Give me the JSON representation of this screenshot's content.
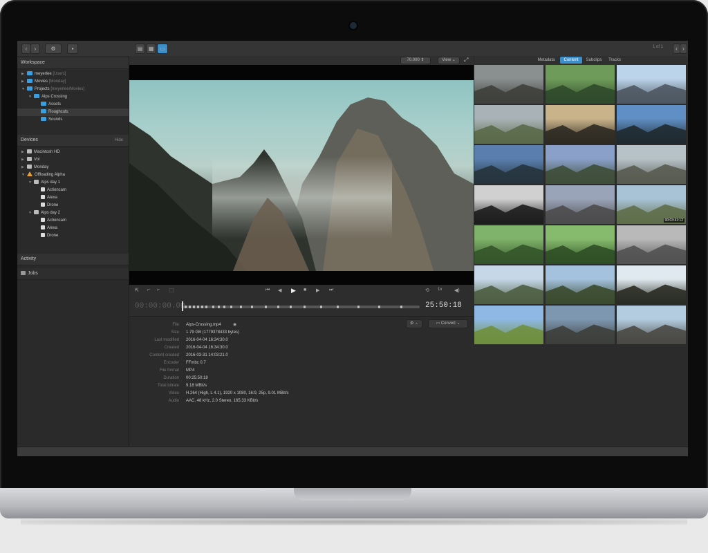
{
  "toolbar": {
    "nav_back": "‹",
    "nav_forward": "›",
    "gear": "⚙",
    "view_buttons": [
      "▤",
      "▦",
      "▭"
    ],
    "page_indicator": "1 of 1",
    "zoom_value": "70.000",
    "view_menu": "View",
    "tabs": [
      "Metadata",
      "Content",
      "Subclips",
      "Tracks"
    ],
    "active_tab": "Content"
  },
  "sidebar": {
    "workspace_title": "Workspace",
    "workspace": [
      {
        "label": "meyerlee",
        "muted": "[Users]",
        "depth": 0
      },
      {
        "label": "Movies",
        "muted": "[Monday]",
        "depth": 0
      },
      {
        "label": "Projects",
        "muted": "[meyerlee/Movies]",
        "depth": 0
      },
      {
        "label": "Alps Crossing",
        "muted": "",
        "depth": 1
      },
      {
        "label": "Assets",
        "muted": "",
        "depth": 2
      },
      {
        "label": "Roughcuts",
        "muted": "",
        "depth": 2
      },
      {
        "label": "Sounds",
        "muted": "",
        "depth": 2
      }
    ],
    "devices_title": "Devices",
    "devices_hide": "Hide",
    "devices": [
      {
        "label": "Macintosh HD",
        "depth": 0,
        "kind": "disk"
      },
      {
        "label": "Vol",
        "depth": 0,
        "kind": "disk"
      },
      {
        "label": "Monday",
        "depth": 0,
        "kind": "disk"
      },
      {
        "label": "Offloading Alpha",
        "depth": 0,
        "kind": "warn"
      },
      {
        "label": "Alps day 1",
        "depth": 1,
        "kind": "disk"
      },
      {
        "label": "Actioncam",
        "depth": 2,
        "kind": "sub"
      },
      {
        "label": "Alexa",
        "depth": 2,
        "kind": "sub"
      },
      {
        "label": "Drone",
        "depth": 2,
        "kind": "sub"
      },
      {
        "label": "Alps day 2",
        "depth": 1,
        "kind": "disk"
      },
      {
        "label": "Actioncam",
        "depth": 2,
        "kind": "sub"
      },
      {
        "label": "Alexa",
        "depth": 2,
        "kind": "sub"
      },
      {
        "label": "Drone",
        "depth": 2,
        "kind": "sub"
      }
    ],
    "activity_title": "Activity",
    "jobs_title": "Jobs"
  },
  "player": {
    "timecode_start": "00:00:00.00",
    "timecode_end": "25:50:18",
    "speed": "1x",
    "progress": 0.01
  },
  "info": {
    "convert_label": "Convert",
    "rows": [
      {
        "k": "File",
        "v": "Alps-Crossing.mp4"
      },
      {
        "k": "Size",
        "v": "1.79 GB (1779378433 bytes)"
      },
      {
        "k": "Last modified",
        "v": "2016-04-04 16:34:30.0"
      },
      {
        "k": "Created",
        "v": "2016-04-04 16:34:30.0"
      },
      {
        "k": "Content created",
        "v": "2016-03-31 14:03:21.0"
      },
      {
        "k": "Encoder",
        "v": "FFmbc 0.7"
      },
      {
        "k": "File format",
        "v": "MP4"
      },
      {
        "k": "Duration",
        "v": "00:25:50:18"
      },
      {
        "k": "Total bitrate",
        "v": "9.18 MBit/s"
      },
      {
        "k": "Video",
        "v": "H.264 (High, L 4.1), 1920 x 1080, 16:9, 25p, 9.01 MBit/s"
      },
      {
        "k": "Audio",
        "v": "AAC, 48 kHz, 2.0 Stereo, 165.33 KBit/s"
      }
    ]
  },
  "thumbnails": [
    {
      "c1": "#8a8f8f",
      "c2": "#3f403c",
      "dur": ""
    },
    {
      "c1": "#6f9b5a",
      "c2": "#2f4a2b",
      "dur": ""
    },
    {
      "c1": "#bcd4ea",
      "c2": "#4e5863",
      "dur": ""
    },
    {
      "c1": "#a9b3b7",
      "c2": "#5a6a4a",
      "dur": ""
    },
    {
      "c1": "#c9b38a",
      "c2": "#2e2a22",
      "dur": ""
    },
    {
      "c1": "#5f8fc4",
      "c2": "#1f2a30",
      "dur": ""
    },
    {
      "c1": "#5a7fae",
      "c2": "#26343d",
      "dur": ""
    },
    {
      "c1": "#8aa0c8",
      "c2": "#3e4e39",
      "dur": ""
    },
    {
      "c1": "#b7c2c8",
      "c2": "#585b50",
      "dur": ""
    },
    {
      "c1": "#d0d0d0",
      "c2": "#1d1d1d",
      "dur": ""
    },
    {
      "c1": "#9aa4b8",
      "c2": "#4c4b4c",
      "dur": ""
    },
    {
      "c1": "#a8c3d6",
      "c2": "#5f6e4a",
      "dur": "00:03:41:12"
    },
    {
      "c1": "#7fb26a",
      "c2": "#34552a",
      "dur": ""
    },
    {
      "c1": "#86bb6e",
      "c2": "#2f4f26",
      "dur": ""
    },
    {
      "c1": "#b9b9b9",
      "c2": "#525252",
      "dur": ""
    },
    {
      "c1": "#c6d8e8",
      "c2": "#4d5e43",
      "dur": ""
    },
    {
      "c1": "#a4c1de",
      "c2": "#3a4a2e",
      "dur": ""
    },
    {
      "c1": "#dfe9ef",
      "c2": "#2a2c24",
      "dur": ""
    },
    {
      "c1": "#8fb8e4",
      "c2": "#6f8f3e",
      "dur": ""
    },
    {
      "c1": "#7d97b0",
      "c2": "#3d3f3b",
      "dur": ""
    },
    {
      "c1": "#b3cce0",
      "c2": "#4a4945",
      "dur": ""
    }
  ]
}
